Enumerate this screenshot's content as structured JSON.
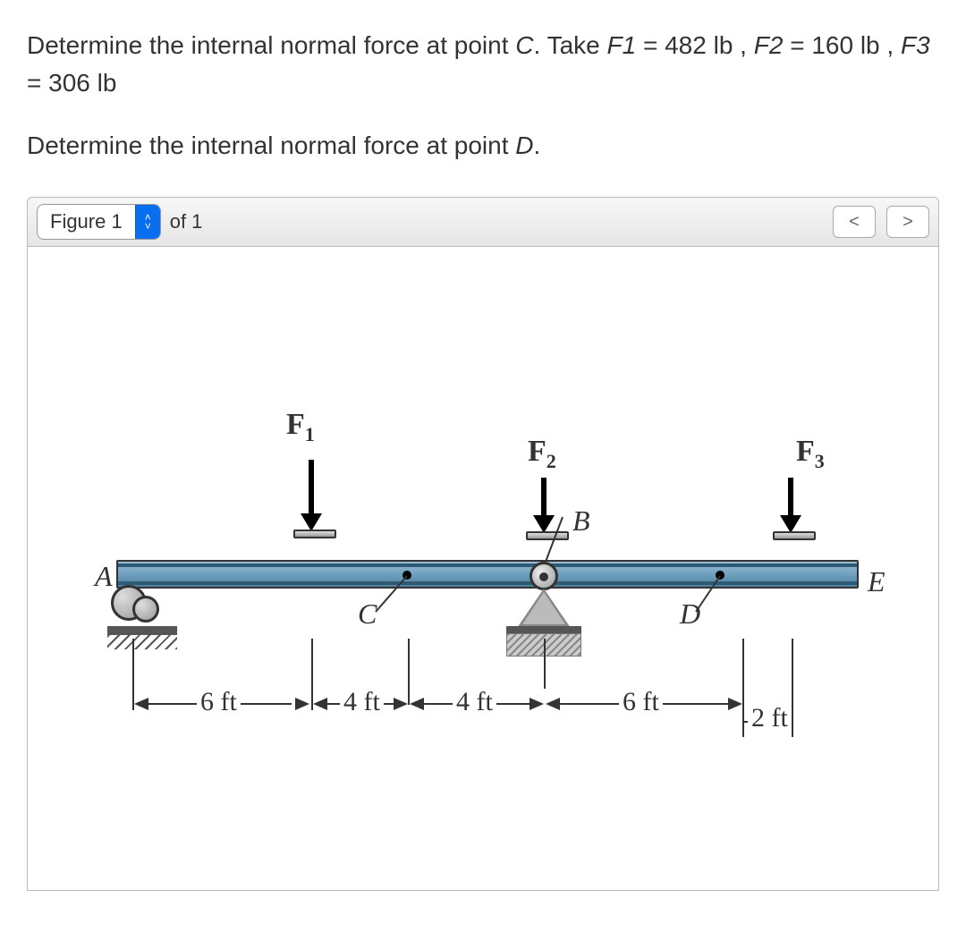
{
  "problem": {
    "line1_part1": "Determine the internal normal force at point ",
    "pointC": "C",
    "line1_part2": ". Take ",
    "var_f1": "F1",
    "line1_part3": " = 482 lb , ",
    "var_f2": "F2",
    "line1_part4": " = 160 lb , ",
    "var_f3": "F3",
    "line1_part5": " = 306 lb",
    "line2_part1": "Determine the internal normal force at point ",
    "pointD": "D",
    "line2_part2": "."
  },
  "figure_header": {
    "selector_label": "Figure 1",
    "of_text": "of 1",
    "prev": "<",
    "next": ">"
  },
  "diagram": {
    "forces": {
      "F1": "F",
      "F1_sub": "1",
      "F2": "F",
      "F2_sub": "2",
      "F3": "F",
      "F3_sub": "3"
    },
    "points": {
      "A": "A",
      "B": "B",
      "C": "C",
      "D": "D",
      "E": "E"
    },
    "dimensions": {
      "d1": "6 ft",
      "d2": "4 ft",
      "d3": "4 ft",
      "d4": "6 ft",
      "d5": "2 ft"
    }
  },
  "chart_data": {
    "type": "diagram",
    "description": "Simply supported beam with pin at A (left end, x=0) and pin/roller at B (x=14 ft). Beam extends to E at x=22 ft. Downward point loads: F1 at x=6 ft, F2 at x=14 ft (over support B), F3 at x=20 ft. Internal force section points: C at x=10 ft, D at x=17 ft.",
    "units": {
      "length": "ft",
      "force": "lb"
    },
    "supports": [
      {
        "name": "A",
        "x": 0,
        "type": "pin"
      },
      {
        "name": "B",
        "x": 14,
        "type": "pin"
      }
    ],
    "beam_length": 22,
    "loads": [
      {
        "name": "F1",
        "x": 6,
        "value": 482,
        "direction": "down"
      },
      {
        "name": "F2",
        "x": 14,
        "value": 160,
        "direction": "down"
      },
      {
        "name": "F3",
        "x": 20,
        "value": 306,
        "direction": "down"
      }
    ],
    "section_points": [
      {
        "name": "C",
        "x": 10
      },
      {
        "name": "D",
        "x": 17
      }
    ],
    "segment_lengths": [
      6,
      4,
      4,
      6,
      2
    ]
  }
}
